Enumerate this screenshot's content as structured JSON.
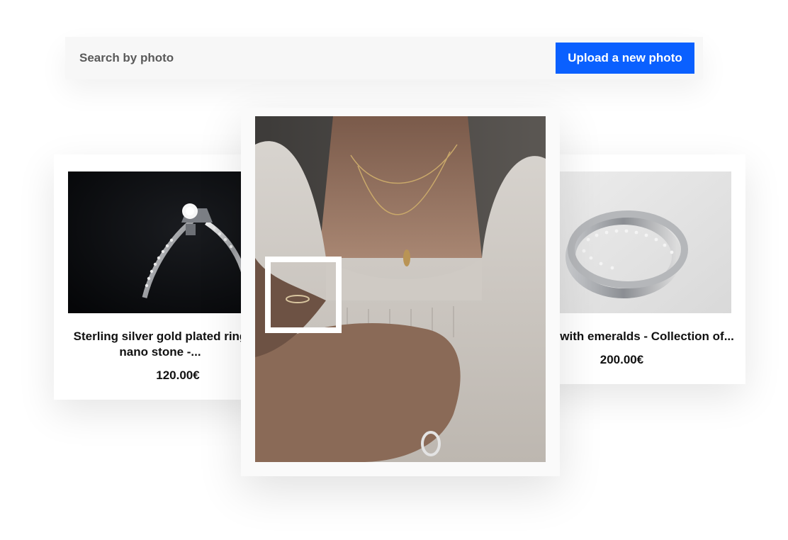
{
  "search": {
    "label": "Search by photo",
    "upload_button": "Upload a new photo"
  },
  "products": [
    {
      "title_line1": "Sterling silver gold plated ring",
      "title_line2": "nano stone -...",
      "price": "120.00€"
    },
    {
      "title": "y with emeralds - Collection of...",
      "price": "200.00€"
    }
  ],
  "colors": {
    "accent": "#0a60ff",
    "search_bg": "#f7f7f7"
  },
  "icons": {
    "selection": "crop-selection-box"
  }
}
